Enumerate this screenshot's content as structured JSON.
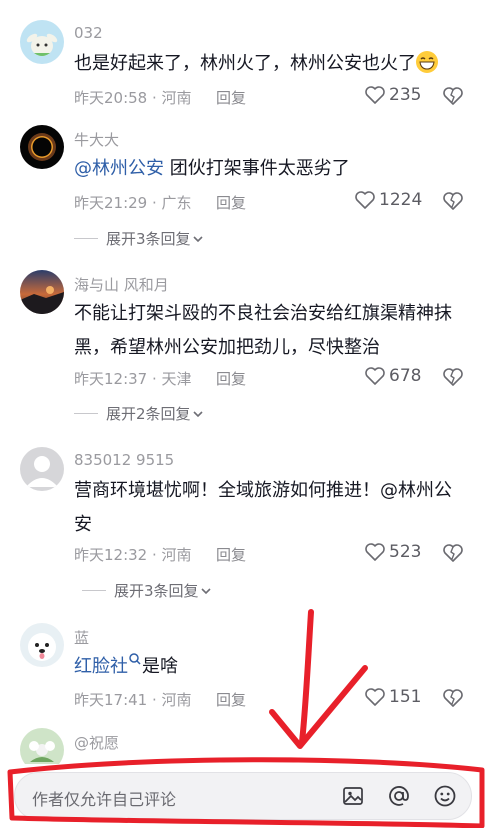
{
  "comments": [
    {
      "username": "032",
      "text": "也是好起来了，林州火了，林州公安也火了",
      "time_location": "昨天20:58 · 河南",
      "reply_label": "回复",
      "likes": "235",
      "avatar_icon": "dog-plush-avatar"
    },
    {
      "username": "牛大大",
      "mention": "@林州公安",
      "text": " 团伙打架事件太恶劣了",
      "time_location": "昨天21:29 · 广东",
      "reply_label": "回复",
      "likes": "1224",
      "expand_label": "展开3条回复",
      "avatar_icon": "solar-eclipse-avatar"
    },
    {
      "username": "海与山 风和月",
      "text": "不能让打架斗殴的不良社会治安给红旗渠精神抹黑，希望林州公安加把劲儿，尽快整治",
      "time_location": "昨天12:37 · 天津",
      "reply_label": "回复",
      "likes": "678",
      "expand_label": "展开2条回复",
      "avatar_icon": "sunset-avatar"
    },
    {
      "username": "835012 9515",
      "text": "营商环境堪忧啊！全域旅游如何推进！",
      "mention": "@林州公安",
      "time_location": "昨天12:32 · 河南",
      "reply_label": "回复",
      "likes": "523",
      "expand_label": "展开3条回复",
      "avatar_icon": "default-user-avatar"
    },
    {
      "username": "蓝",
      "link": "红脸社",
      "text": "是啥",
      "time_location": "昨天17:41 · 河南",
      "reply_label": "回复",
      "likes": "151",
      "avatar_icon": "white-dog-avatar"
    },
    {
      "username": "@祝愿",
      "avatar_icon": "flower-avatar"
    }
  ],
  "comment_bar": {
    "placeholder": "作者仅允许自己评论",
    "icons": [
      "image-icon",
      "at-icon",
      "emoji-icon"
    ]
  },
  "colors": {
    "mention": "#2f5fa8",
    "annotation": "#e8202a"
  }
}
